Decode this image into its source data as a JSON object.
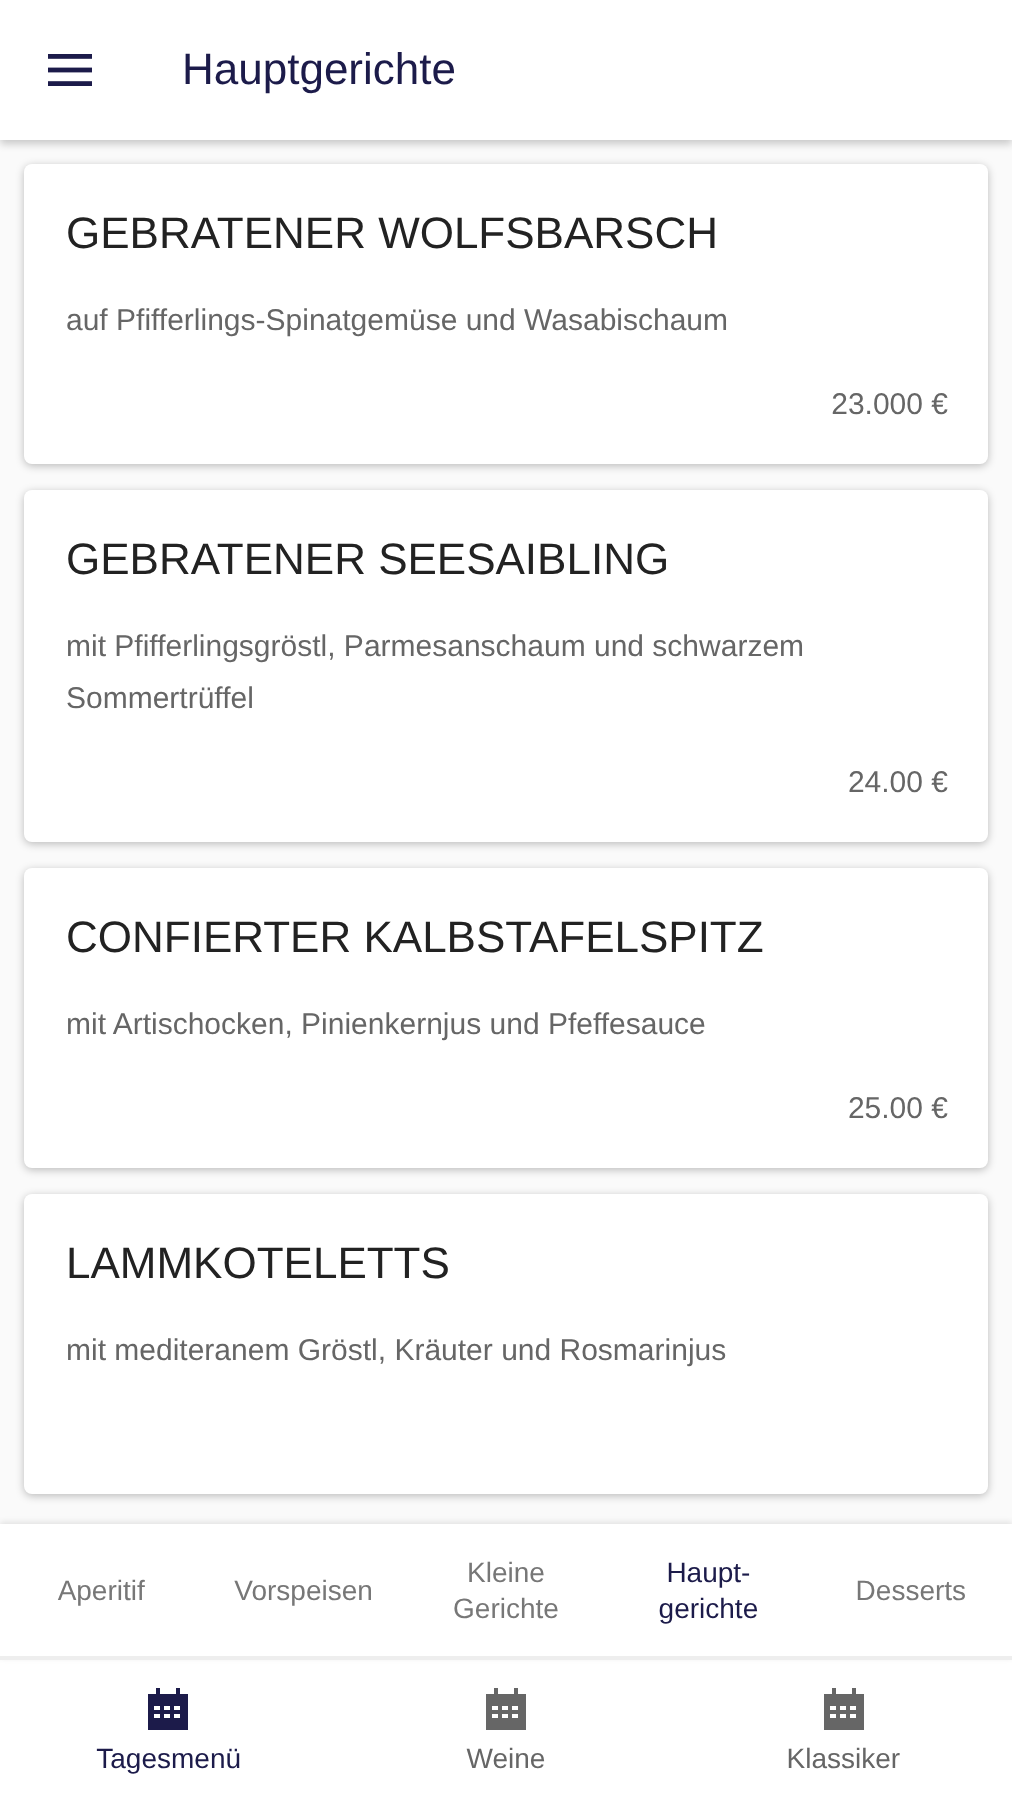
{
  "app_bar": {
    "title": "Hauptgerichte"
  },
  "dishes": [
    {
      "name": "GEBRATENER WOLFSBARSCH",
      "description": "auf Pfifferlings-Spinatgemüse und Wasabischaum",
      "price": "23.000 €"
    },
    {
      "name": "GEBRATENER SEESAIBLING",
      "description": "mit Pfifferlingsgröstl, Parmesanschaum und schwarzem Sommertrüffel",
      "price": "24.00 €"
    },
    {
      "name": "CONFIERTER KALBSTAFELSPITZ",
      "description": "mit Artischocken, Pinienkernjus und Pfeffesauce",
      "price": "25.00 €"
    },
    {
      "name": "LAMMKOTELETTS",
      "description": "mit mediteranem Gröstl, Kräuter und Rosmarinjus"
    }
  ],
  "category_tabs": [
    {
      "label": "Aperitif",
      "selected": false
    },
    {
      "label": "Vorspeisen",
      "selected": false
    },
    {
      "label": "Kleine\nGerichte",
      "selected": false
    },
    {
      "label": "Haupt-\ngerichte",
      "selected": true
    },
    {
      "label": "Desserts",
      "selected": false
    }
  ],
  "bottom_nav": [
    {
      "label": "Tagesmenü",
      "selected": true
    },
    {
      "label": "Weine",
      "selected": false
    },
    {
      "label": "Klassiker",
      "selected": false
    }
  ]
}
